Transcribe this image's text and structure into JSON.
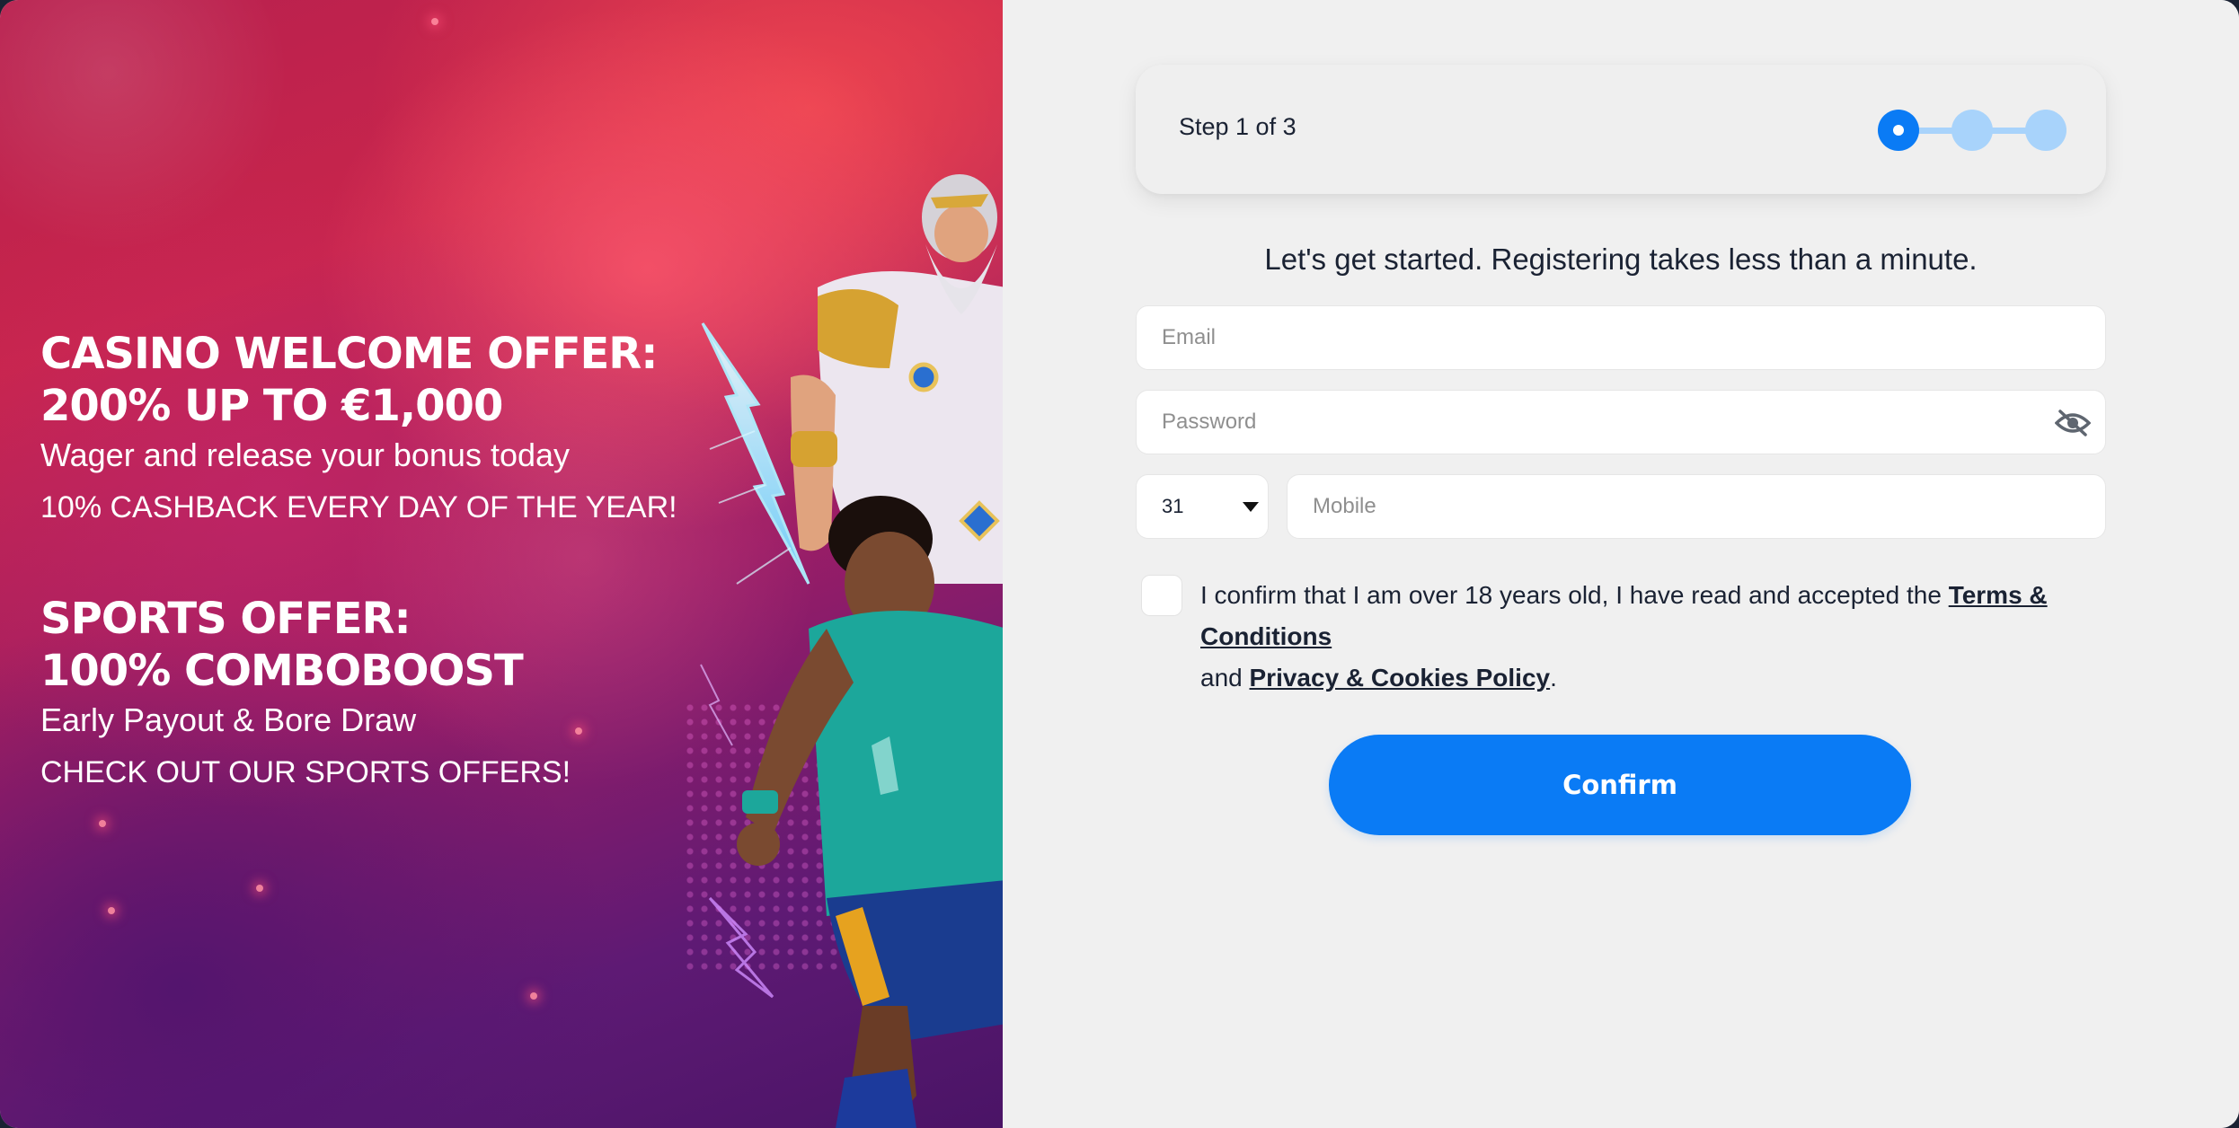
{
  "promo": {
    "casino_title_line1": "CASINO WELCOME OFFER:",
    "casino_title_line2": "200% UP TO €1,000",
    "casino_subtitle": "Wager and release your bonus today",
    "casino_cta": "10% CASHBACK EVERY DAY OF THE YEAR!",
    "sports_title_line1": "SPORTS OFFER:",
    "sports_title_line2": "100% COMBOBOOST",
    "sports_subtitle": "Early Payout & Bore Draw",
    "sports_cta": "CHECK OUT OUR SPORTS OFFERS!"
  },
  "stepper": {
    "label": "Step 1 of 3",
    "current_step": 1,
    "total_steps": 3
  },
  "form": {
    "intro": "Let's get started. Registering takes less than a minute.",
    "email_placeholder": "Email",
    "password_placeholder": "Password",
    "country_code": "31",
    "mobile_placeholder": "Mobile",
    "consent_text_1": "I confirm that I am over 18 years old, I have read and accepted the ",
    "terms_link": "Terms & Conditions",
    "consent_text_2": "and ",
    "privacy_link": "Privacy & Cookies Policy",
    "consent_text_3": ".",
    "confirm_label": "Confirm"
  },
  "colors": {
    "accent": "#0a7bf5",
    "stepper_inactive": "#a8d3fb",
    "panel_bg": "#f0f0f0",
    "text": "#1a2233"
  },
  "icons": {
    "password_toggle": "eye-slash-icon",
    "country_dropdown": "caret-down-icon"
  }
}
